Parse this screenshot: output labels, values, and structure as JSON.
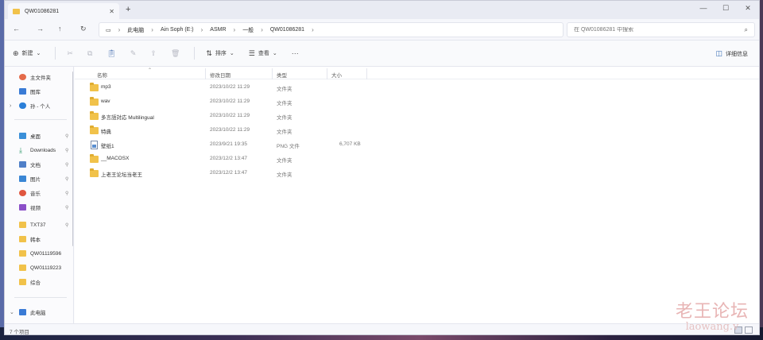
{
  "window": {
    "tab_title": "QW01086281",
    "tab_close": "✕",
    "new_tab": "+",
    "controls": [
      "—",
      "☐",
      "✕"
    ]
  },
  "address": {
    "back": "←",
    "forward": "→",
    "up": "↑",
    "refresh": "↻",
    "breadcrumb": [
      "此电脑",
      "Ain Soph (E:)",
      "ASMR",
      "一般",
      "QW01086281"
    ],
    "search_placeholder": "在 QW01086281 中搜索"
  },
  "toolbar": {
    "new_label": "新建",
    "sort_label": "排序",
    "view_label": "查看",
    "more": "···",
    "details_label": "详细信息"
  },
  "sidebar": {
    "items": [
      {
        "label": "主文件夹",
        "color": "#e46b4a"
      },
      {
        "label": "图库",
        "color": "#3a7bd5"
      },
      {
        "label": "孙 - 个人",
        "color": "#2b7fd8"
      },
      {
        "label": "桌面",
        "color": "#3a8fd8"
      },
      {
        "label": "Downloads",
        "color": "#2e9a6a"
      },
      {
        "label": "文档",
        "color": "#4f7fc8"
      },
      {
        "label": "图片",
        "color": "#3a86d4"
      },
      {
        "label": "音乐",
        "color": "#e0563f"
      },
      {
        "label": "视频",
        "color": "#8b4fc8"
      },
      {
        "label": "TXT37",
        "color": "#f1c24a"
      },
      {
        "label": "韩本",
        "color": "#f1c24a"
      },
      {
        "label": "QW01119596",
        "color": "#f1c24a"
      },
      {
        "label": "QW01119223",
        "color": "#f1c24a"
      },
      {
        "label": "综合",
        "color": "#f1c24a"
      },
      {
        "label": "此电脑",
        "color": "#3a7bd5"
      }
    ],
    "pin": "⚲"
  },
  "columns": {
    "name": "名称",
    "date": "修改日期",
    "type": "类型",
    "size": "大小"
  },
  "files": [
    {
      "name": "mp3",
      "date": "2023/10/22 11:29",
      "type": "文件夹",
      "size": ""
    },
    {
      "name": "wav",
      "date": "2023/10/22 11:29",
      "type": "文件夹",
      "size": ""
    },
    {
      "name": "多言語対応 Multilingual",
      "date": "2023/10/22 11:29",
      "type": "文件夹",
      "size": ""
    },
    {
      "name": "特典",
      "date": "2023/10/22 11:29",
      "type": "文件夹",
      "size": ""
    },
    {
      "name": "壁纸1",
      "date": "2023/9/21 19:35",
      "type": "PNG 文件",
      "size": "6,707 KB"
    },
    {
      "name": "__MACOSX",
      "date": "2023/12/2 13:47",
      "type": "文件夹",
      "size": ""
    },
    {
      "name": "上老王论坛当老王",
      "date": "2023/12/2 13:47",
      "type": "文件夹",
      "size": ""
    }
  ],
  "status": {
    "count": "7 个项目"
  },
  "watermark": {
    "main": "老王论坛",
    "sub": "laowang.v"
  }
}
